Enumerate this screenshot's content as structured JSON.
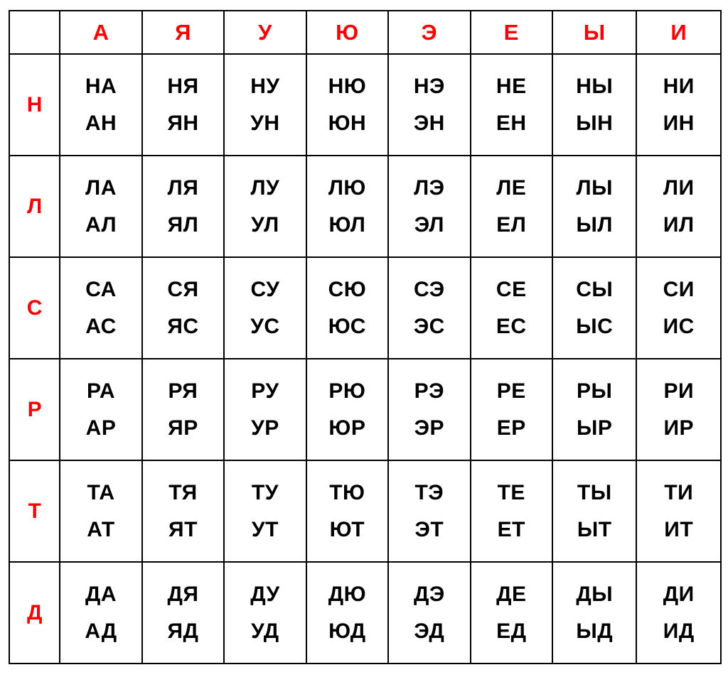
{
  "table": {
    "colors": {
      "header_red": "#ff0000",
      "syllable_black": "#000000",
      "grid_line": "#000000",
      "background": "#ffffff"
    },
    "corner_label": "",
    "vowel_headers": [
      "А",
      "Я",
      "У",
      "Ю",
      "Э",
      "Е",
      "Ы",
      "И"
    ],
    "consonant_labels": [
      "Н",
      "Л",
      "С",
      "Р",
      "Т",
      "Д"
    ],
    "rows": [
      {
        "consonant": "Н",
        "cells": [
          {
            "forward": "НА",
            "reverse": "АН"
          },
          {
            "forward": "НЯ",
            "reverse": "ЯН"
          },
          {
            "forward": "НУ",
            "reverse": "УН"
          },
          {
            "forward": "НЮ",
            "reverse": "ЮН"
          },
          {
            "forward": "НЭ",
            "reverse": "ЭН"
          },
          {
            "forward": "НЕ",
            "reverse": "ЕН"
          },
          {
            "forward": "НЫ",
            "reverse": "ЫН"
          },
          {
            "forward": "НИ",
            "reverse": "ИН"
          }
        ]
      },
      {
        "consonant": "Л",
        "cells": [
          {
            "forward": "ЛА",
            "reverse": "АЛ"
          },
          {
            "forward": "ЛЯ",
            "reverse": "ЯЛ"
          },
          {
            "forward": "ЛУ",
            "reverse": "УЛ"
          },
          {
            "forward": "ЛЮ",
            "reverse": "ЮЛ"
          },
          {
            "forward": "ЛЭ",
            "reverse": "ЭЛ"
          },
          {
            "forward": "ЛЕ",
            "reverse": "ЕЛ"
          },
          {
            "forward": "ЛЫ",
            "reverse": "ЫЛ"
          },
          {
            "forward": "ЛИ",
            "reverse": "ИЛ"
          }
        ]
      },
      {
        "consonant": "С",
        "cells": [
          {
            "forward": "СА",
            "reverse": "АС"
          },
          {
            "forward": "СЯ",
            "reverse": "ЯС"
          },
          {
            "forward": "СУ",
            "reverse": "УС"
          },
          {
            "forward": "СЮ",
            "reverse": "ЮС"
          },
          {
            "forward": "СЭ",
            "reverse": "ЭС"
          },
          {
            "forward": "СЕ",
            "reverse": "ЕС"
          },
          {
            "forward": "СЫ",
            "reverse": "ЫС"
          },
          {
            "forward": "СИ",
            "reverse": "ИС"
          }
        ]
      },
      {
        "consonant": "Р",
        "cells": [
          {
            "forward": "РА",
            "reverse": "АР"
          },
          {
            "forward": "РЯ",
            "reverse": "ЯР"
          },
          {
            "forward": "РУ",
            "reverse": "УР"
          },
          {
            "forward": "РЮ",
            "reverse": "ЮР"
          },
          {
            "forward": "РЭ",
            "reverse": "ЭР"
          },
          {
            "forward": "РЕ",
            "reverse": "ЕР"
          },
          {
            "forward": "РЫ",
            "reverse": "ЫР"
          },
          {
            "forward": "РИ",
            "reverse": "ИР"
          }
        ]
      },
      {
        "consonant": "Т",
        "cells": [
          {
            "forward": "ТА",
            "reverse": "АТ"
          },
          {
            "forward": "ТЯ",
            "reverse": "ЯТ"
          },
          {
            "forward": "ТУ",
            "reverse": "УТ"
          },
          {
            "forward": "ТЮ",
            "reverse": "ЮТ"
          },
          {
            "forward": "ТЭ",
            "reverse": "ЭТ"
          },
          {
            "forward": "ТЕ",
            "reverse": "ЕТ"
          },
          {
            "forward": "ТЫ",
            "reverse": "ЫТ"
          },
          {
            "forward": "ТИ",
            "reverse": "ИТ"
          }
        ]
      },
      {
        "consonant": "Д",
        "cells": [
          {
            "forward": "ДА",
            "reverse": "АД"
          },
          {
            "forward": "ДЯ",
            "reverse": "ЯД"
          },
          {
            "forward": "ДУ",
            "reverse": "УД"
          },
          {
            "forward": "ДЮ",
            "reverse": "ЮД"
          },
          {
            "forward": "ДЭ",
            "reverse": "ЭД"
          },
          {
            "forward": "ДЕ",
            "reverse": "ЕД"
          },
          {
            "forward": "ДЫ",
            "reverse": "ЫД"
          },
          {
            "forward": "ДИ",
            "reverse": "ИД"
          }
        ]
      }
    ]
  }
}
